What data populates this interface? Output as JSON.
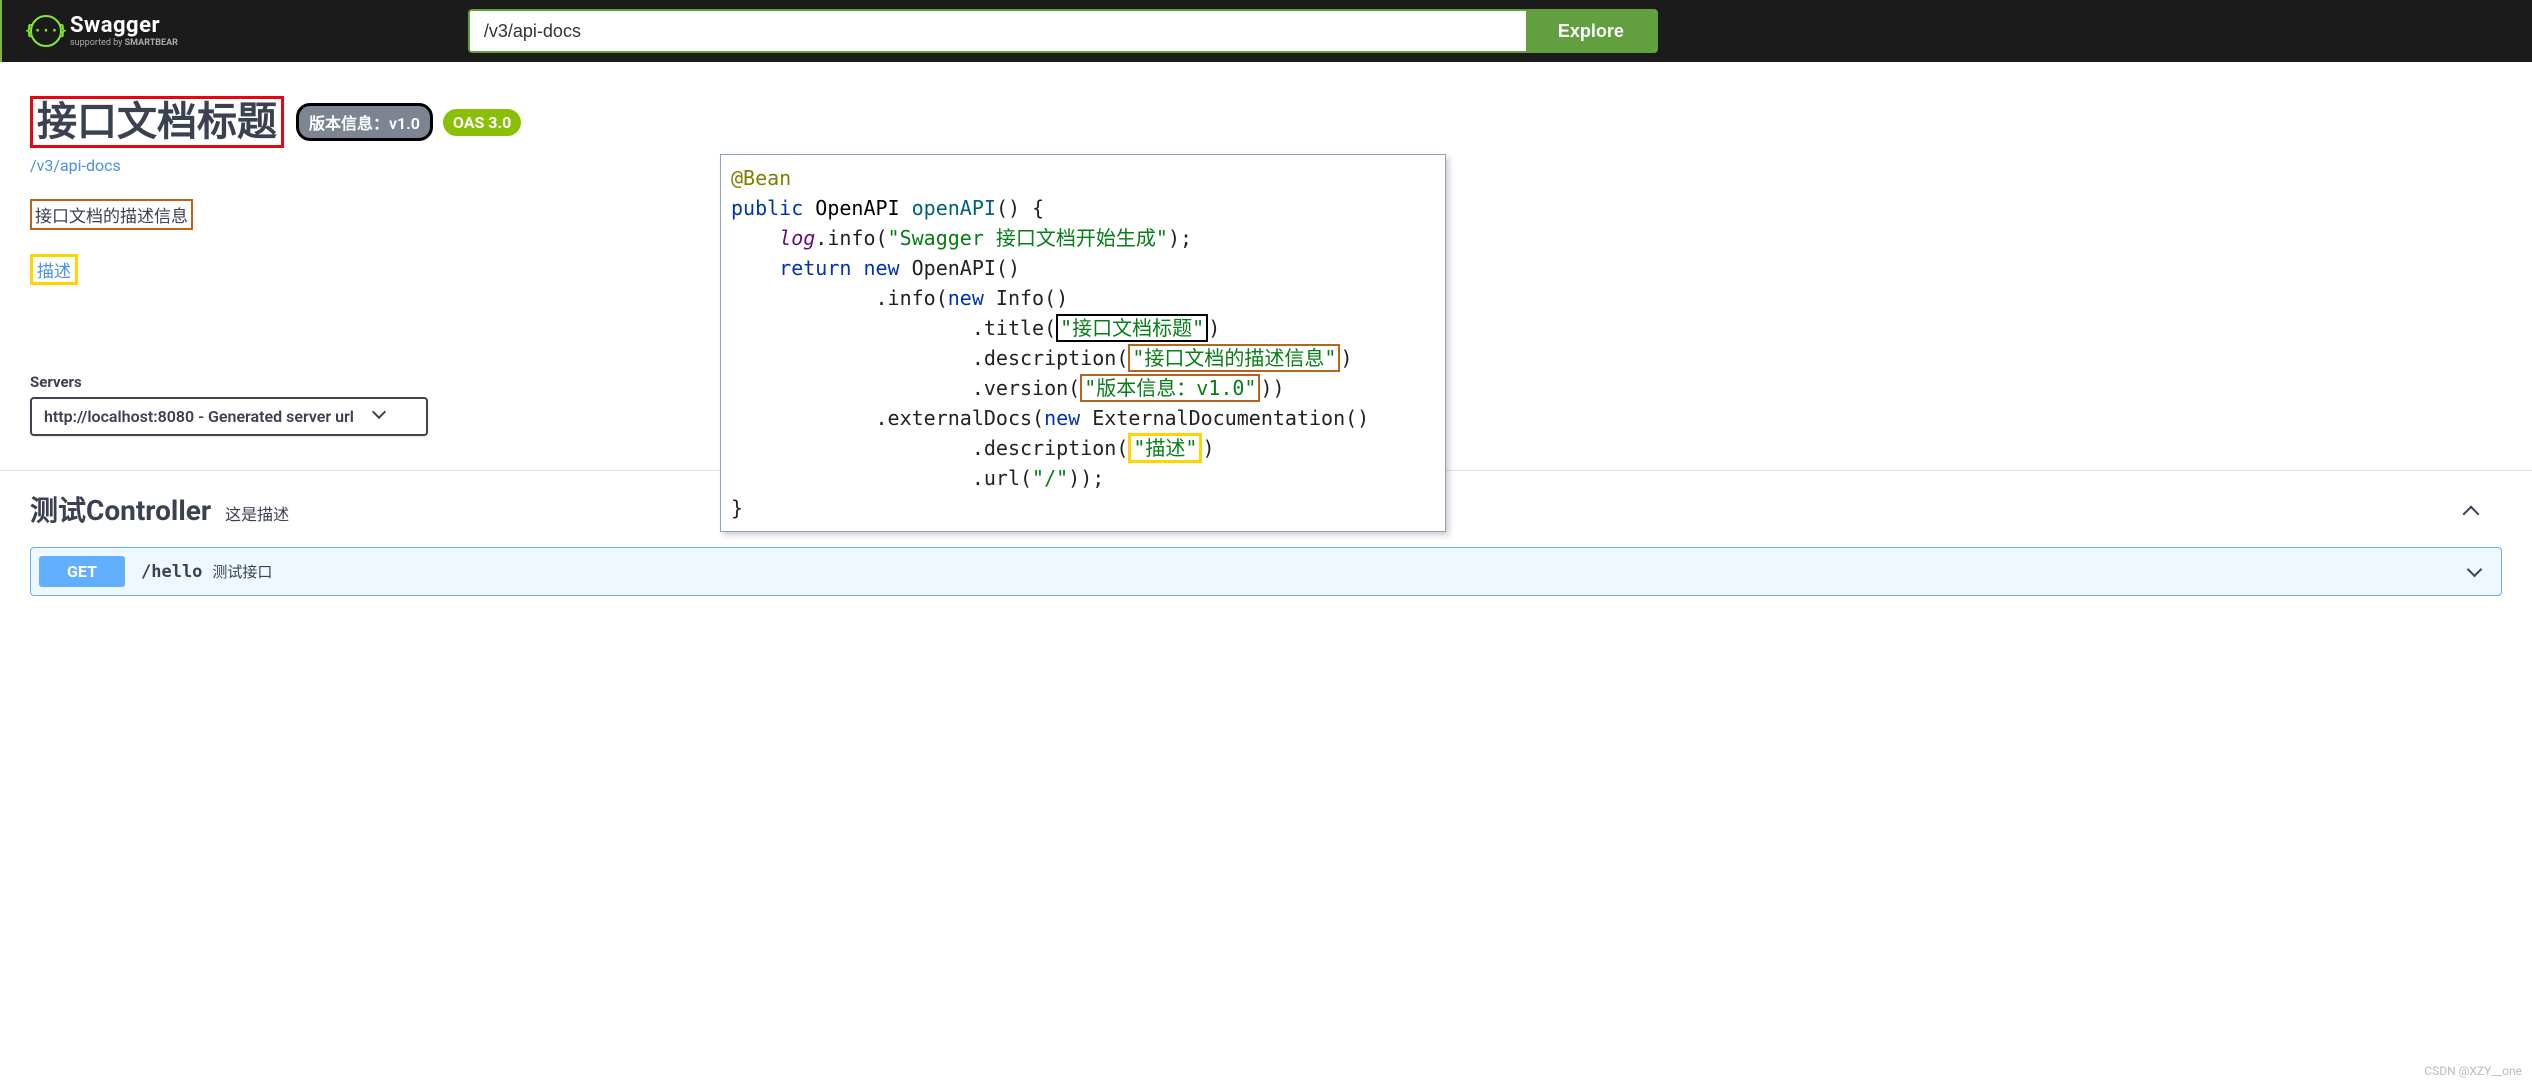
{
  "topbar": {
    "brand": "Swagger",
    "sub_prefix": "supported by ",
    "sub_brand": "SMARTBEAR",
    "logo_glyph": "{···}",
    "search_value": "/v3/api-docs",
    "explore_label": "Explore"
  },
  "info": {
    "title": "接口文档标题",
    "version_badge": "版本信息：v1.0",
    "oas_badge": "OAS 3.0",
    "base_url": "/v3/api-docs",
    "description": "接口文档的描述信息",
    "external_desc": "描述"
  },
  "servers": {
    "label": "Servers",
    "selected": "http://localhost:8080 - Generated server url"
  },
  "tag": {
    "name": "测试Controller",
    "description": "这是描述"
  },
  "operation": {
    "method": "GET",
    "path": "/hello",
    "summary": "测试接口"
  },
  "code": {
    "annot": "@Bean",
    "kw_public": "public",
    "ret_type": "OpenAPI",
    "fn": "openAPI",
    "log": "log",
    "info_call": ".info(",
    "log_str": "\"Swagger 接口文档开始生成\"",
    "kw_return": "return",
    "kw_new": "new",
    "OpenAPI_ctor": "OpenAPI()",
    "info_m": ".info(",
    "Info_ctor": "Info()",
    "title_m": ".title(",
    "title_str": "\"接口文档标题\"",
    "desc_m": ".description(",
    "desc_str": "\"接口文档的描述信息\"",
    "ver_m": ".version(",
    "ver_str": "\"版本信息：v1.0\"",
    "ext_m": ".externalDocs(",
    "ExtDoc_ctor": "ExternalDocumentation()",
    "ext_desc_str": "\"描述\"",
    "url_m": ".url(",
    "url_str": "\"/\""
  },
  "watermark": "CSDN @XZY__one"
}
